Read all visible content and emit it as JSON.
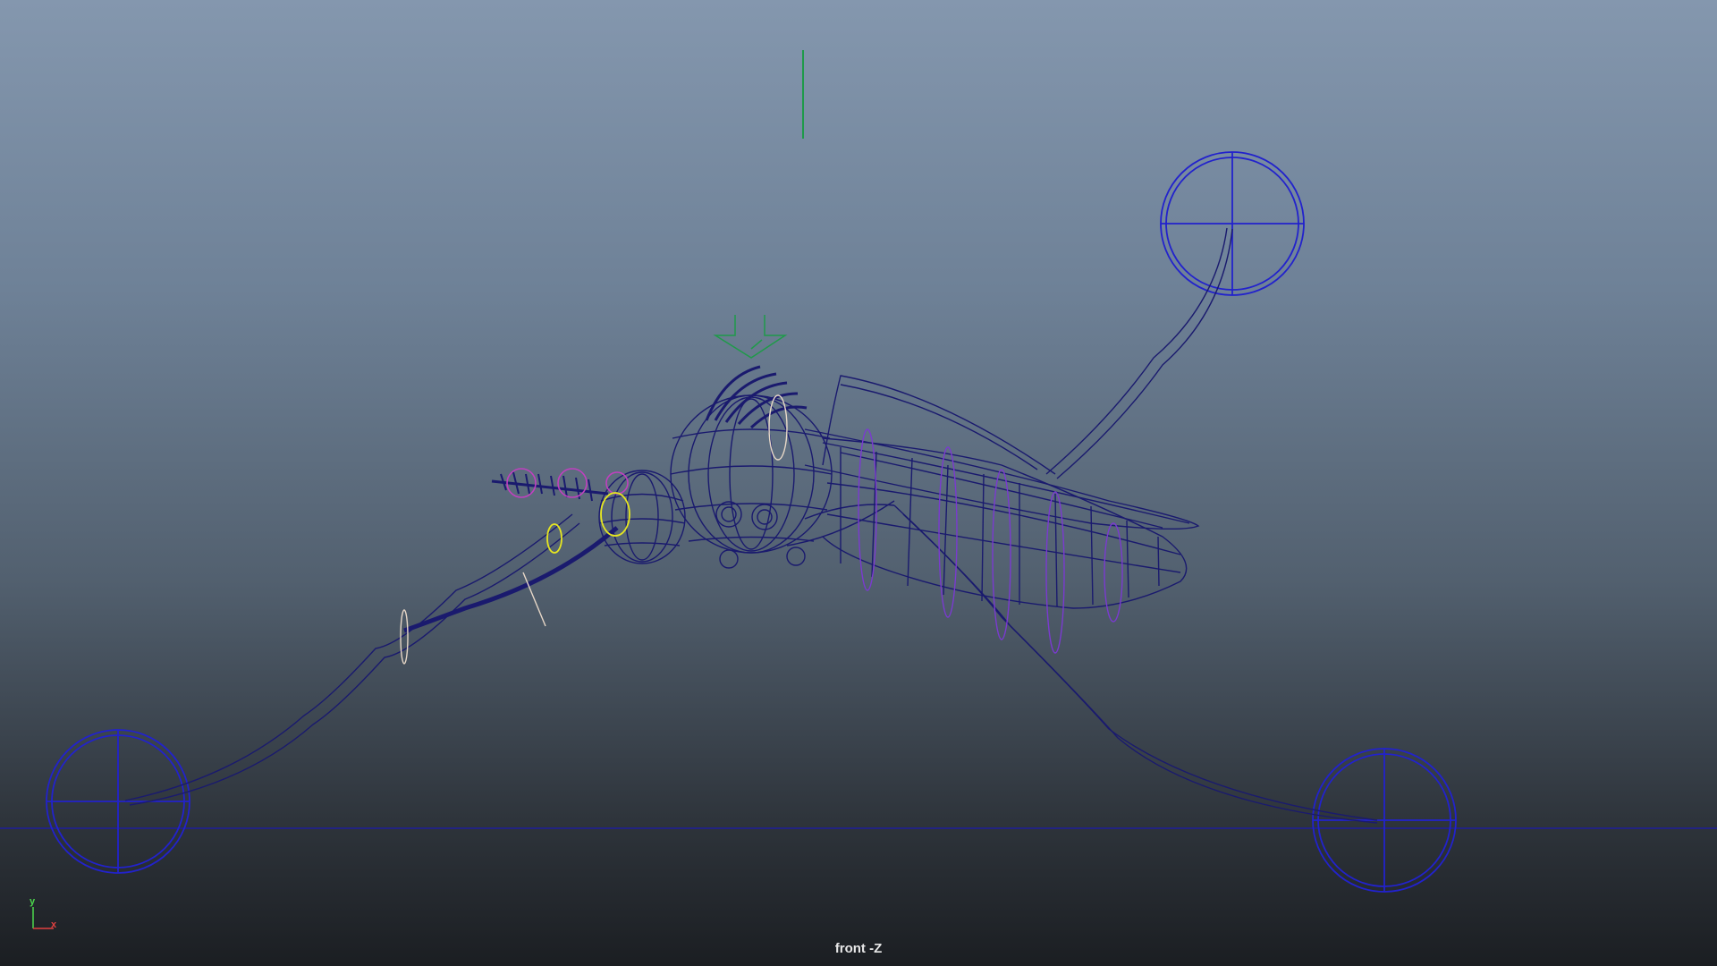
{
  "viewport": {
    "camera_label": "front -Z",
    "axis_labels": {
      "y": "y",
      "x": "x"
    }
  },
  "colors": {
    "wireframe": "#1a1a6e",
    "controller": "#2222cc",
    "selection_yellow": "#e6e620",
    "selection_magenta": "#c040c0",
    "purple_rings": "#7a3ad0",
    "green_locator": "#1f9a4a",
    "ground_line": "#1e1e9a"
  },
  "icons": {
    "axis_gizmo": "axis-gizmo-icon",
    "foot_controllers": "circle-crosshair-icon",
    "camera_locator": "arrow-locator-icon"
  }
}
